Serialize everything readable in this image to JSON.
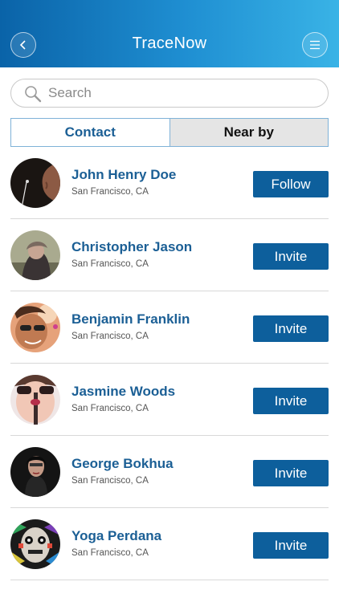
{
  "header": {
    "title": "TraceNow",
    "back_icon": "chevron-left-icon",
    "menu_icon": "hamburger-menu-icon"
  },
  "search": {
    "placeholder": "Search",
    "value": "",
    "icon": "search-icon"
  },
  "tabs": [
    {
      "label": "Contact",
      "selected": true
    },
    {
      "label": "Near by",
      "selected": false
    }
  ],
  "contacts": [
    {
      "name": "John Henry Doe",
      "location": "San Francisco, CA",
      "action": "Follow"
    },
    {
      "name": "Christopher Jason",
      "location": "San Francisco, CA",
      "action": "Invite"
    },
    {
      "name": "Benjamin Franklin",
      "location": "San Francisco, CA",
      "action": "Invite"
    },
    {
      "name": "Jasmine Woods",
      "location": "San Francisco, CA",
      "action": "Invite"
    },
    {
      "name": "George Bokhua",
      "location": "San Francisco, CA",
      "action": "Invite"
    },
    {
      "name": "Yoga Perdana",
      "location": "San Francisco, CA",
      "action": "Invite"
    }
  ],
  "colors": {
    "accent": "#1b5f95",
    "button": "#0d5f9c",
    "header_start": "#0a63a8",
    "header_end": "#39b3e6"
  }
}
